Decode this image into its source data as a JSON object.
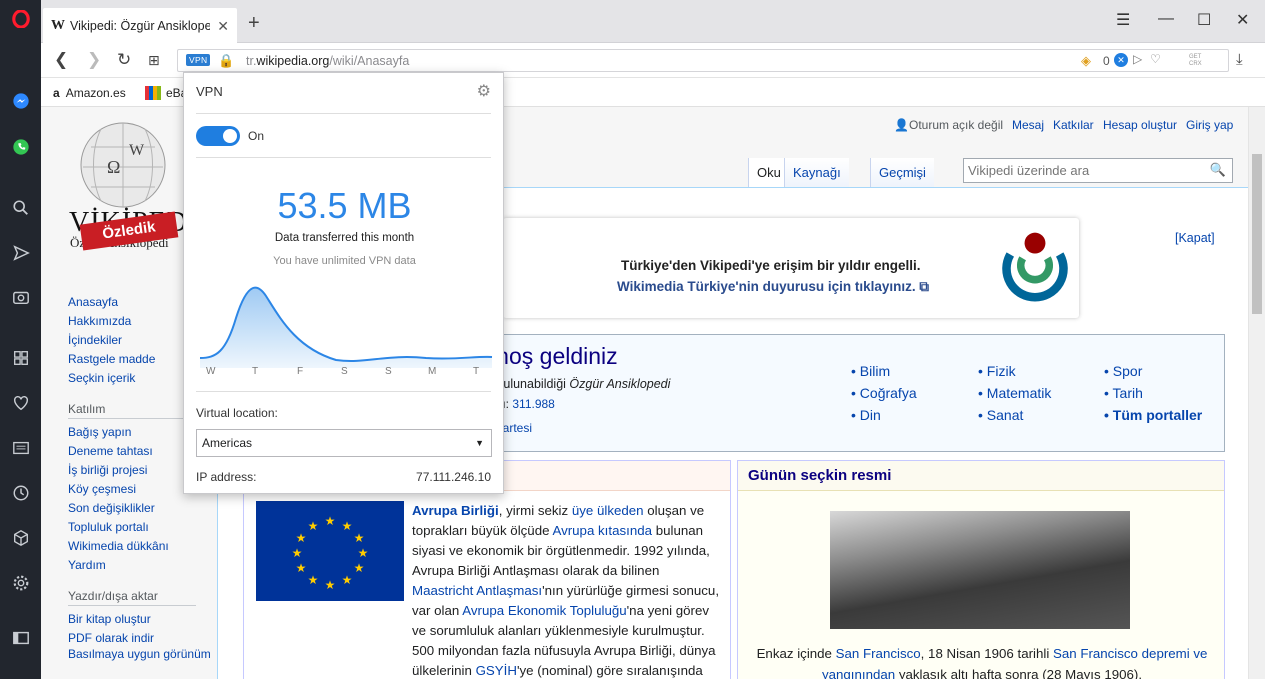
{
  "browser": {
    "tab_title": "Vikipedi: Özgür Ansiklopedi",
    "tab_favicon": "W",
    "vpn_badge": "VPN",
    "url_domain": "tr.wikipedia.org",
    "url_path": "/wiki/Anasayfa",
    "url_scheme": "tr.",
    "ad_block_count": "0",
    "getcrx": "GET CRX",
    "bookmarks": [
      "Amazon.es",
      "eBay"
    ]
  },
  "vpn_popup": {
    "title": "VPN",
    "toggle_label": "On",
    "data_amount": "53.5 MB",
    "data_label": "Data transferred this month",
    "unlimited_note": "You have unlimited VPN data",
    "chart_days": [
      "W",
      "T",
      "F",
      "S",
      "S",
      "M",
      "T"
    ],
    "location_label": "Virtual location:",
    "location_value": "Americas",
    "ip_label": "IP address:",
    "ip_value": "77.111.246.10",
    "accent": "#1f7ee0"
  },
  "wiki": {
    "wordmark": "VİKİPEDİ",
    "tagline": "Özgür Ansiklopedi",
    "ribbon": "Özledik",
    "personal": {
      "not_logged": "Oturum açık değil",
      "links": [
        "Mesaj",
        "Katkılar",
        "Hesap oluştur",
        "Giriş yap"
      ]
    },
    "tabs": [
      "Oku",
      "Kaynağı gör",
      "Geçmişi gör"
    ],
    "search_placeholder": "Vikipedi üzerinde ara",
    "nav": {
      "main": [
        "Anasayfa",
        "Hakkımızda",
        "İçindekiler",
        "Rastgele madde",
        "Seçkin içerik"
      ],
      "participation_heading": "Katılım",
      "participation": [
        "Bağış yapın",
        "Deneme tahtası",
        "İş birliği projesi",
        "Köy çeşmesi",
        "Son değişiklikler",
        "Topluluk portalı",
        "Wikimedia dükkânı",
        "Yardım"
      ],
      "print_heading": "Yazdır/dışa aktar",
      "print": [
        "Bir kitap oluştur",
        "PDF olarak indir",
        "Basılmaya uygun görünüm"
      ]
    },
    "banner": {
      "close": "[Kapat]",
      "line1": "Türkiye'den Vikipedi'ye erişim bir yıldır engelli.",
      "line2": "Wikimedia Türkiye'nin duyurusu için tıklayınız."
    },
    "welcome": {
      "title_tail": "e hoş geldiniz",
      "line1_tail": "a bulunabildiği",
      "line1_italic": "Özgür Ansiklopedi",
      "count_prefix": "yısı:",
      "count": "311.988",
      "date_tail": "Pazartesi"
    },
    "portals": [
      [
        "Bilim",
        "Coğrafya",
        "Din"
      ],
      [
        "Fizik",
        "Matematik",
        "Sanat"
      ],
      [
        "Spor",
        "Tarih",
        "Tüm portaller"
      ]
    ],
    "featured": {
      "link_title": "Avrupa Birliği",
      "t1": ", yirmi sekiz ",
      "l1": "üye ülkeden",
      "t2": " oluşan ve toprakları büyük ölçüde ",
      "l2": "Avrupa kıtasında",
      "t3": " bulunan siyasi ve ekonomik bir örgütlenmedir. 1992 yılında, Avrupa Birliği Antlaşması olarak da bilinen ",
      "l3": "Maastricht Antlaşması",
      "t4": "'nın yürürlüğe girmesi sonucu, var olan ",
      "l4": "Avrupa Ekonomik Topluluğu",
      "t5": "'na yeni görev ve sorumluluk alanları yüklenmesiyle kurulmuştur. 500 milyondan fazla nüfusuyla Avrupa Birliği, dünya ülkelerinin ",
      "l5": "GSYİH",
      "t6": "'ye (nominal) göre sıralanışında nominal gayrisafi yurt"
    },
    "potd": {
      "heading": "Günün seçkin resmi",
      "c1": "Enkaz içinde ",
      "l1": "San Francisco",
      "c2": ", 18 Nisan 1906 tarihli ",
      "l2": "San Francisco depremi ve yangınından",
      "c3": " yaklaşık altı hafta sonra (28 Mayıs 1906)."
    }
  }
}
